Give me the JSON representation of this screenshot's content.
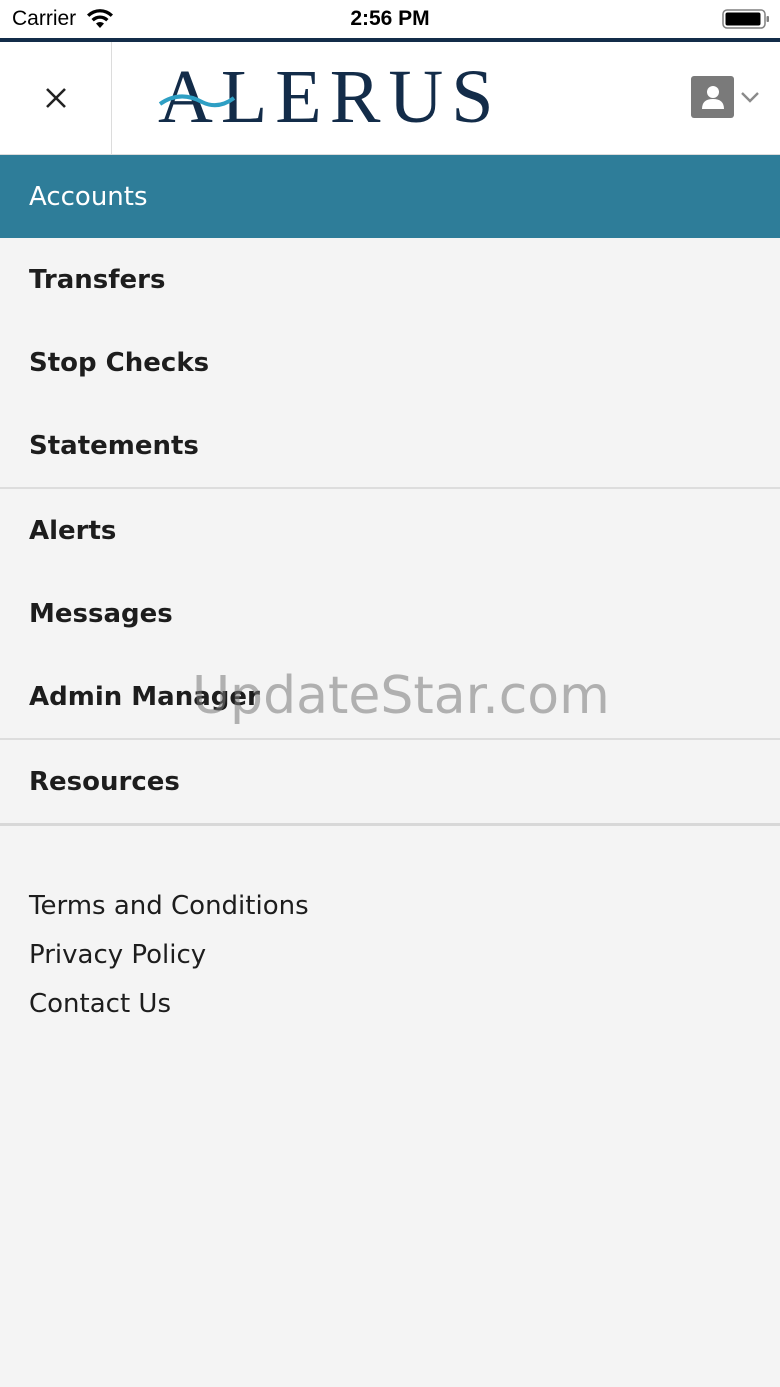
{
  "status_bar": {
    "carrier": "Carrier",
    "time": "2:56 PM"
  },
  "header": {
    "logo_text": "ALERUS",
    "brand_color": "#132c49",
    "accent_color": "#2e7d99"
  },
  "menu": {
    "items": [
      {
        "label": "Accounts",
        "active": true
      },
      {
        "label": "Transfers"
      },
      {
        "label": "Stop Checks"
      },
      {
        "label": "Statements"
      },
      {
        "label": "Alerts"
      },
      {
        "label": "Messages"
      },
      {
        "label": "Admin Manager"
      },
      {
        "label": "Resources"
      }
    ]
  },
  "footer": {
    "links": [
      "Terms and Conditions",
      "Privacy Policy",
      "Contact Us"
    ]
  },
  "watermark": "UpdateStar.com"
}
